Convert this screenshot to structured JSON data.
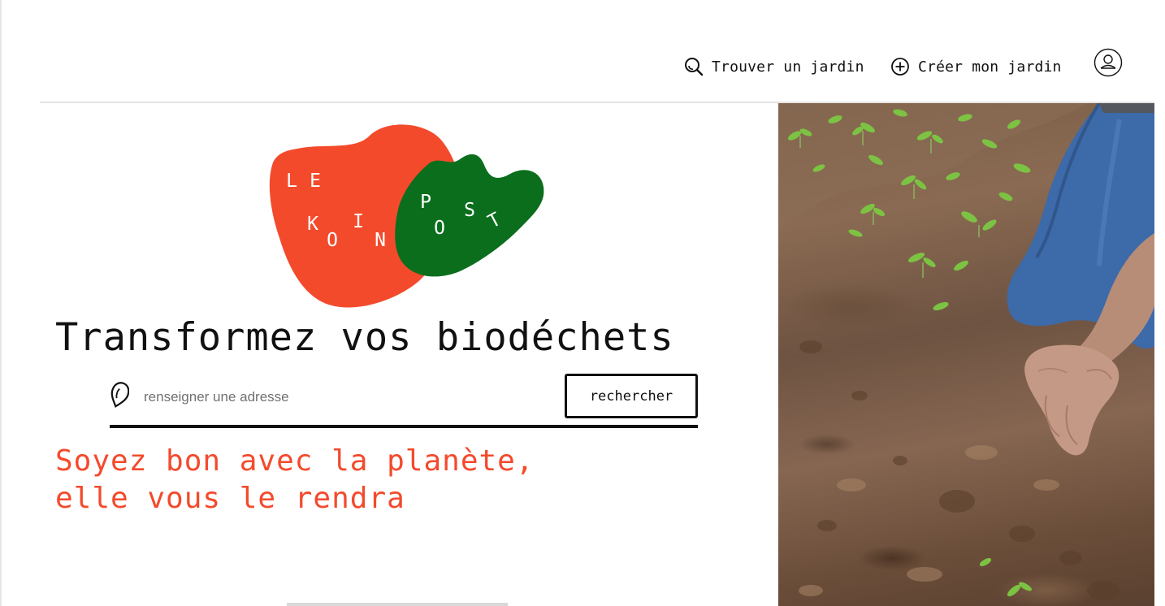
{
  "header": {
    "find_garden_label": "Trouver un jardin",
    "find_garden_icon": "search-icon",
    "create_garden_label": "Créer mon jardin",
    "create_garden_icon": "plus-circle-icon",
    "user_icon": "user-icon"
  },
  "logo": {
    "text_le": [
      "L",
      "E"
    ],
    "text_koin": [
      "K",
      "O",
      "I",
      "N"
    ],
    "text_post": [
      "P",
      "O",
      "S",
      "T"
    ],
    "colors": {
      "orange": "#f44a2c",
      "green": "#0b6e1d"
    }
  },
  "hero": {
    "headline": "Transformez vos biodéchets",
    "tagline_line1": "Soyez bon avec la planète,",
    "tagline_line2": "elle vous le rendra"
  },
  "search": {
    "icon": "map-pin-icon",
    "placeholder": "renseigner une adresse",
    "value": "",
    "button_label": "rechercher"
  },
  "image": {
    "subject": "hand-planting-seedlings-photo"
  },
  "colors": {
    "accent": "#f44a2c",
    "text": "#111111",
    "background": "#ffffff"
  }
}
